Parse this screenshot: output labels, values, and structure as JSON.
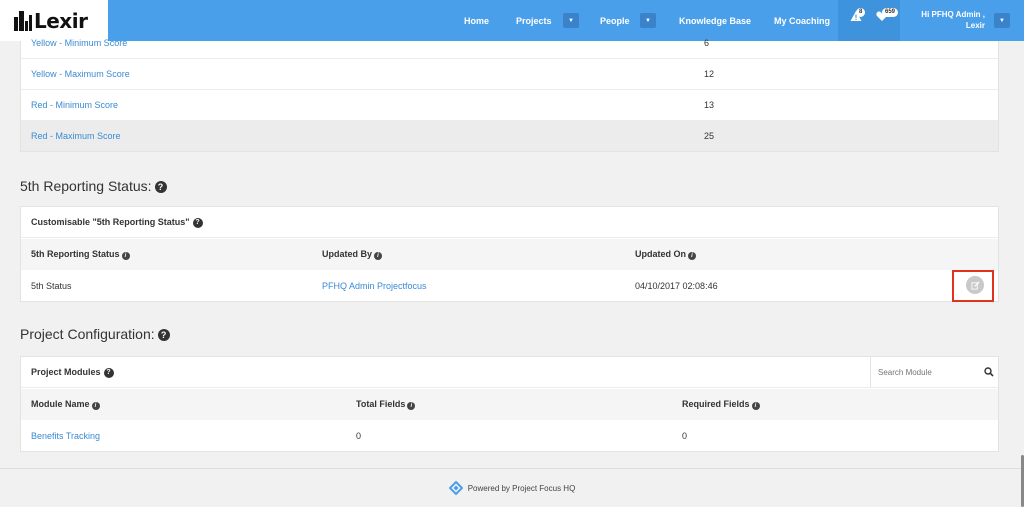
{
  "brand": {
    "logo_text": "Lexir"
  },
  "nav": {
    "items": [
      {
        "label": "Home"
      },
      {
        "label": "Projects"
      },
      {
        "label": "People"
      },
      {
        "label": "Knowledge Base"
      },
      {
        "label": "My Coaching"
      }
    ],
    "alerts_count": "8",
    "likes_count": "659",
    "user_line1": "Hi PFHQ Admin ,",
    "user_line2": "Lexir",
    "caret": "▼"
  },
  "score_table": {
    "rows": [
      {
        "label": "Yellow - Minimum Score",
        "value": "6"
      },
      {
        "label": "Yellow - Maximum Score",
        "value": "12"
      },
      {
        "label": "Red - Minimum Score",
        "value": "13"
      },
      {
        "label": "Red - Maximum Score",
        "value": "25"
      }
    ]
  },
  "reporting_status": {
    "section_title": "5th Reporting Status:",
    "panel_title": "Customisable \"5th Reporting Status\"",
    "columns": [
      "5th Reporting Status",
      "Updated By",
      "Updated On"
    ],
    "row": {
      "status": "5th Status",
      "updated_by": "PFHQ Admin Projectfocus",
      "updated_on": "04/10/2017 02:08:46"
    }
  },
  "project_config": {
    "section_title": "Project Configuration:",
    "panel_title": "Project Modules",
    "search_placeholder": "Search Module",
    "columns": [
      "Module Name",
      "Total Fields",
      "Required Fields"
    ],
    "row": {
      "module": "Benefits Tracking",
      "total": "0",
      "required": "0"
    }
  },
  "footer": {
    "text": "Powered by Project Focus HQ"
  },
  "colors": {
    "nav_bg": "#4a9fea",
    "link": "#3a8ad4",
    "highlight": "#e0321f"
  },
  "icons": [
    "buildings-icon",
    "caret-down-icon",
    "alert-icon",
    "heart-icon",
    "chevron-down-icon",
    "help-icon",
    "info-icon",
    "edit-icon",
    "search-icon",
    "diamond-logo-icon"
  ]
}
